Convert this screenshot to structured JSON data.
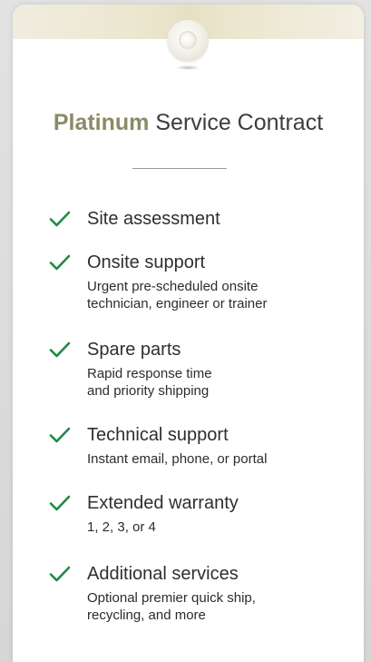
{
  "card": {
    "title_accent": "Platinum",
    "title_rest": "Service Contract",
    "medallion_icon": "medallion-badge-icon"
  },
  "colors": {
    "accent": "#8a8b66",
    "check": "#1f8a46",
    "text": "#2f2f2f"
  },
  "features": [
    {
      "title": "Site assessment",
      "description": ""
    },
    {
      "title": "Onsite support",
      "description": "Urgent pre-scheduled onsite\ntechnician, engineer or trainer"
    },
    {
      "title": "Spare parts",
      "description": "Rapid response time\nand priority shipping"
    },
    {
      "title": "Technical support",
      "description": "Instant email, phone, or portal"
    },
    {
      "title": "Extended warranty",
      "description": "1, 2, 3, or 4"
    },
    {
      "title": "Additional services",
      "description": "Optional premier quick ship,\nrecycling, and more"
    }
  ]
}
